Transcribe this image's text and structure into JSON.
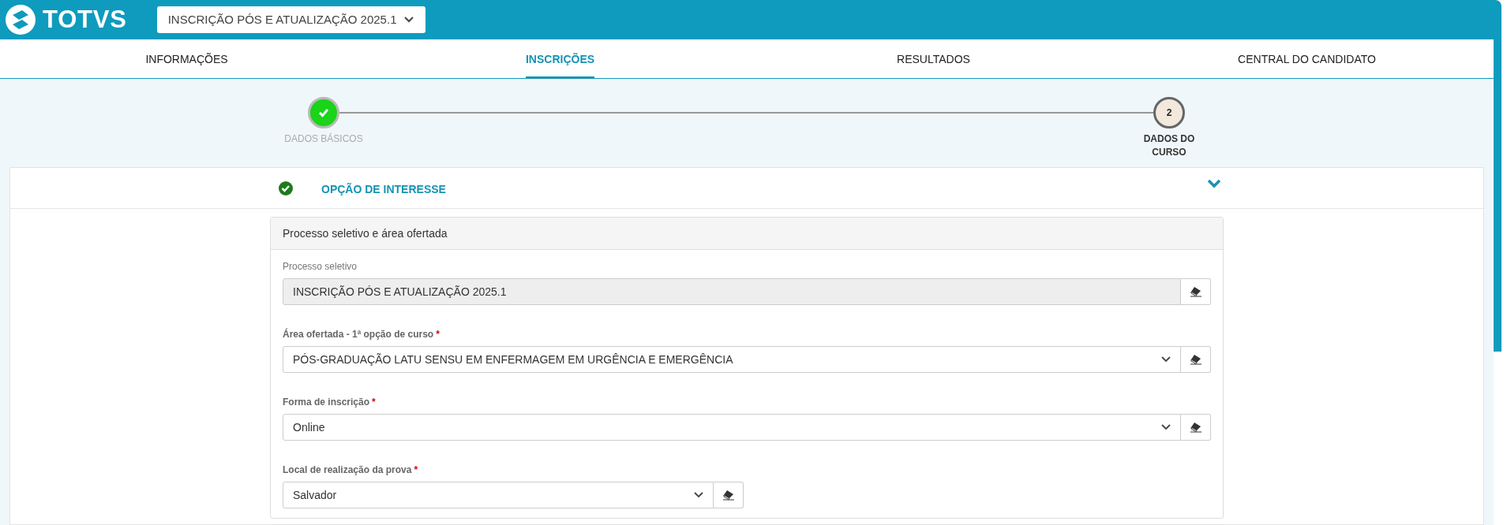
{
  "header": {
    "logo_text": "TOTVS",
    "process_select": {
      "value": "INSCRIÇÃO PÓS E ATUALIZAÇÃO 2025.1"
    }
  },
  "tabs": [
    {
      "label": "INFORMAÇÕES",
      "selected": false
    },
    {
      "label": "INSCRIÇÕES",
      "selected": true
    },
    {
      "label": "RESULTADOS",
      "selected": false
    },
    {
      "label": "CENTRAL DO CANDIDATO",
      "selected": false
    }
  ],
  "stepper": [
    {
      "label": "DADOS BÁSICOS",
      "completed": true,
      "current": false
    },
    {
      "label": "DADOS DO CURSO",
      "completed": false,
      "current": true,
      "number": "2"
    }
  ],
  "section": {
    "title": "OPÇÃO DE INTERESSE",
    "completed": true,
    "expanded": true,
    "panel": {
      "title": "Processo seletivo e área ofertada",
      "fields": [
        {
          "kind": "readonly",
          "label": "Processo seletivo",
          "value": "INSCRIÇÃO PÓS E ATUALIZAÇÃO 2025.1",
          "wide": true
        },
        {
          "kind": "select",
          "label": "Área ofertada - 1ª opção de curso",
          "required_mark": "*",
          "value": "PÓS-GRADUAÇÃO LATU SENSU EM ENFERMAGEM EM URGÊNCIA E EMERGÊNCIA",
          "wide": true
        },
        {
          "kind": "select",
          "label": "Forma de inscrição",
          "required_mark": "*",
          "value": "Online",
          "wide": true
        },
        {
          "kind": "select",
          "label": "Local de realização da prova",
          "required_mark": "*",
          "value": "Salvador",
          "wide": false
        }
      ]
    }
  }
}
